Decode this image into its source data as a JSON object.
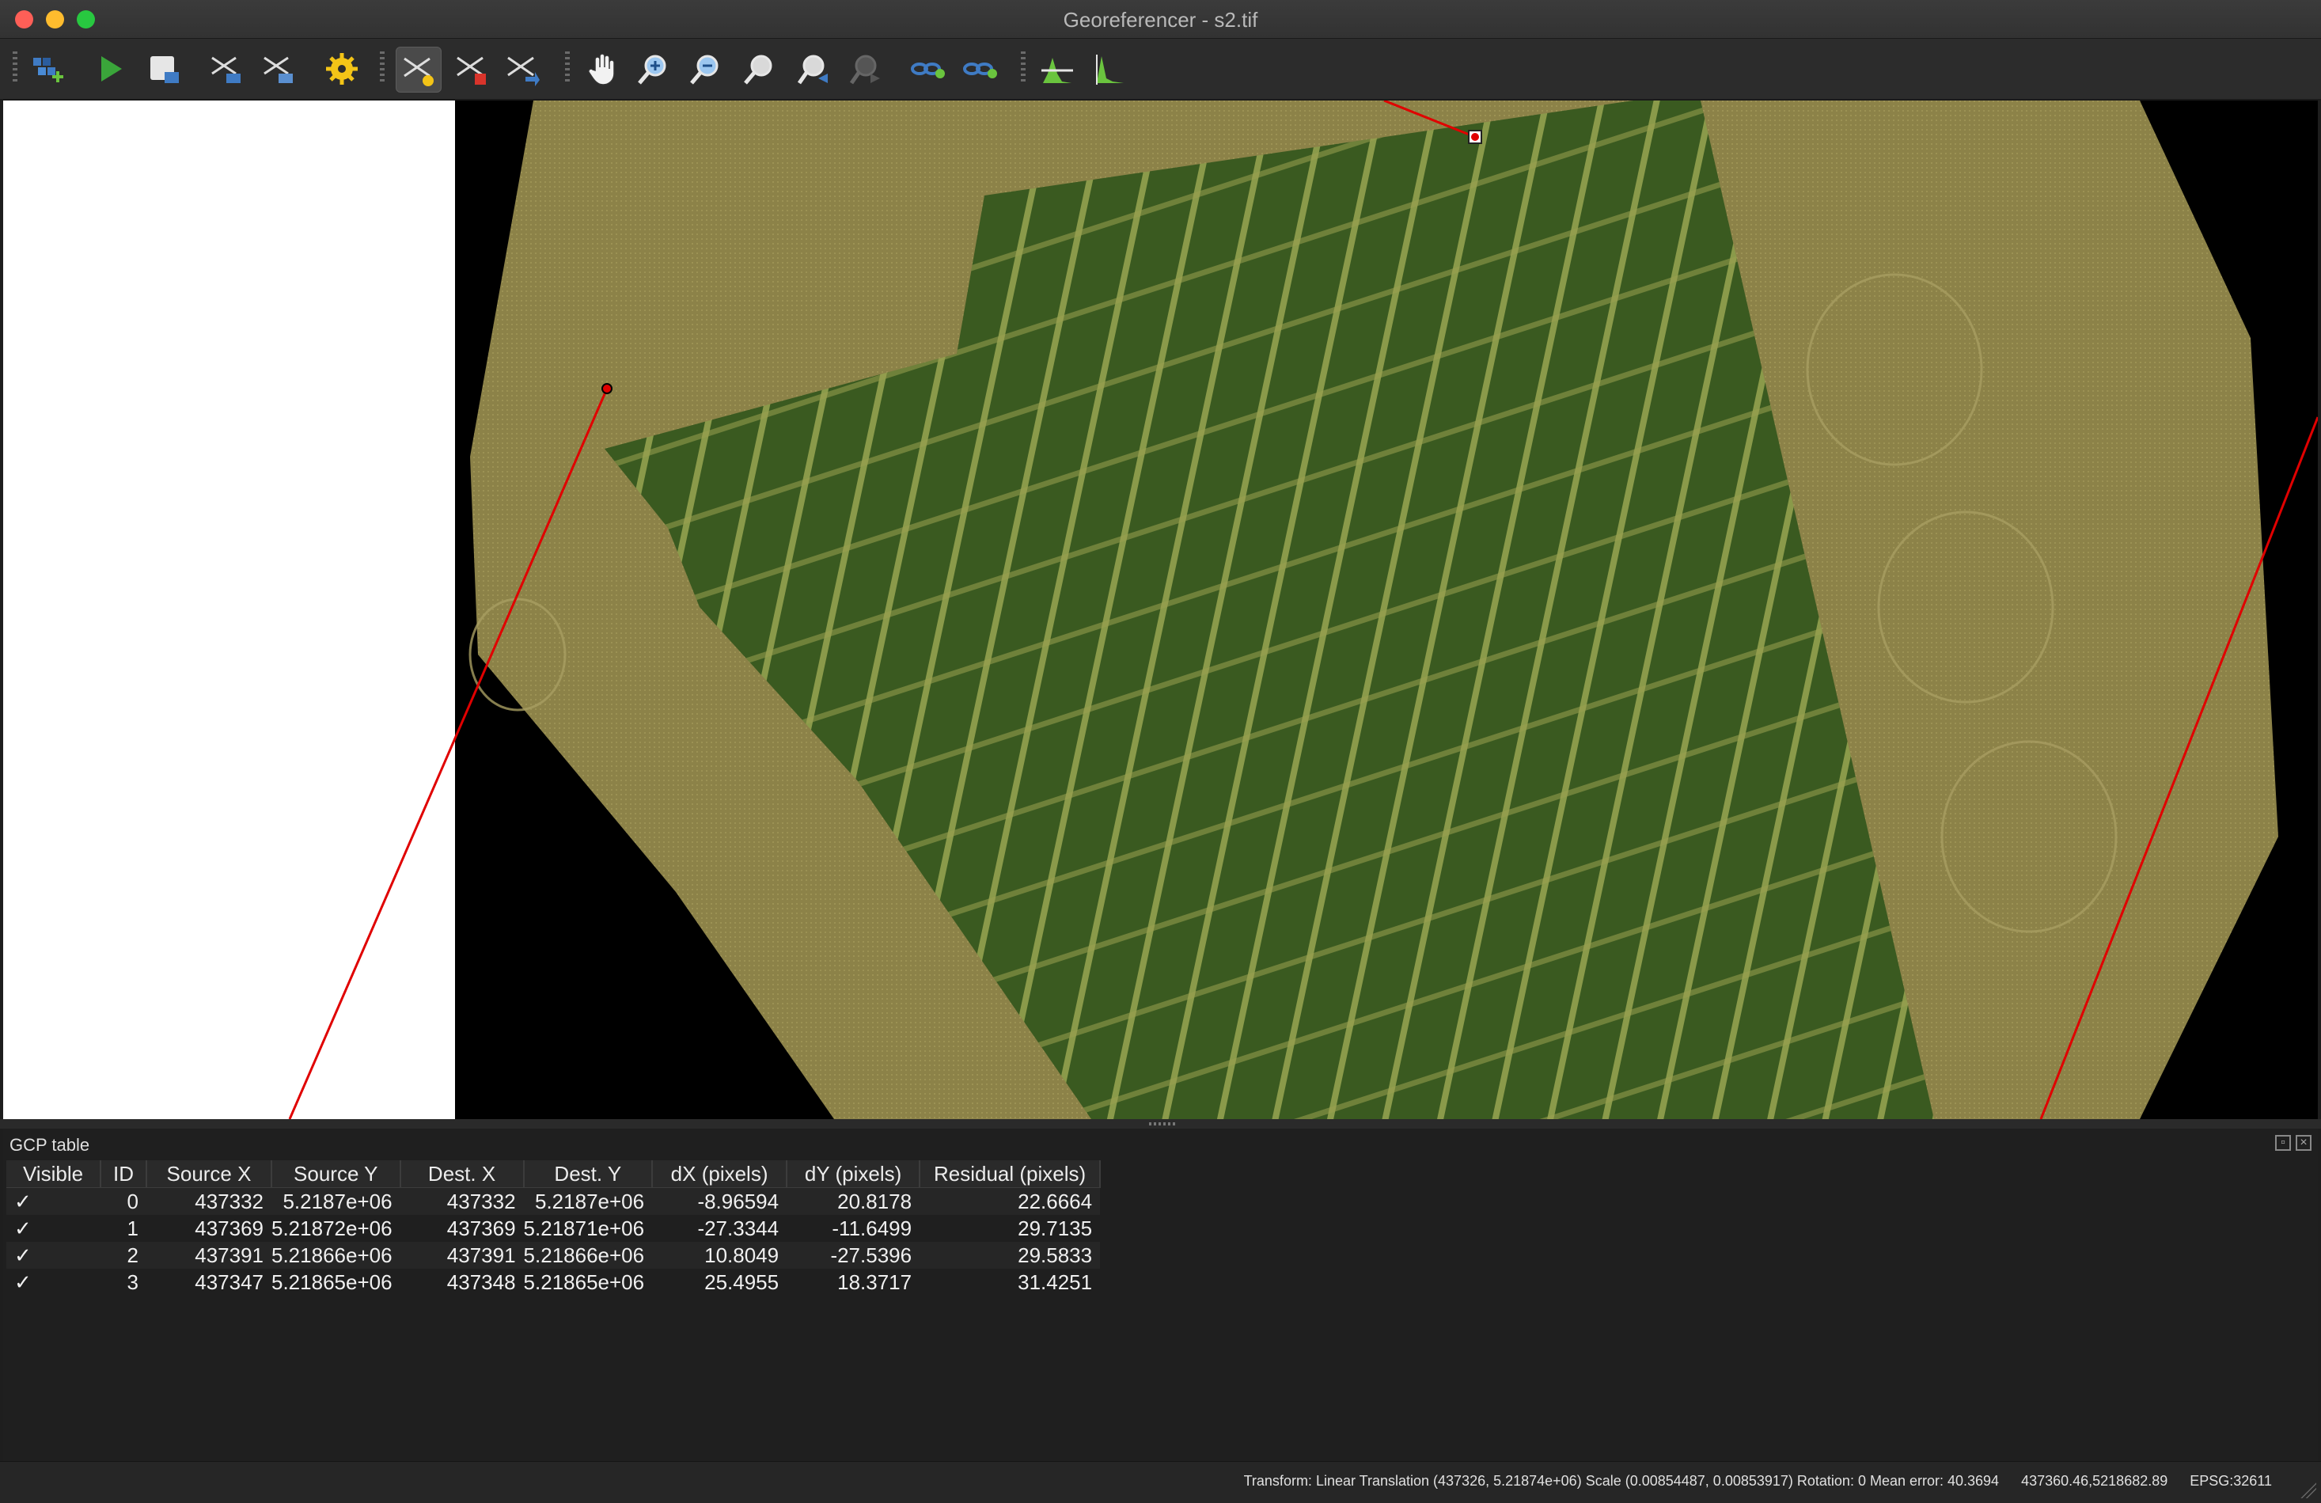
{
  "window": {
    "title": "Georeferencer - s2.tif"
  },
  "toolbar": {
    "buttons": [
      {
        "icon": "open-raster-icon",
        "label": "Open Raster"
      },
      {
        "icon": "start-georeferencing-icon",
        "label": "Start Georeferencing"
      },
      {
        "icon": "generate-gdal-script-icon",
        "label": "Generate GDAL Script"
      },
      {
        "icon": "load-gcp-points-icon",
        "label": "Load GCP Points"
      },
      {
        "icon": "save-gcp-points-icon",
        "label": "Save GCP Points As"
      },
      {
        "icon": "transformation-settings-icon",
        "label": "Transformation Settings"
      },
      {
        "icon": "add-point-icon",
        "label": "Add Point"
      },
      {
        "icon": "delete-point-icon",
        "label": "Delete Point"
      },
      {
        "icon": "move-gcp-point-icon",
        "label": "Move GCP Point"
      },
      {
        "icon": "pan-icon",
        "label": "Pan"
      },
      {
        "icon": "zoom-in-icon",
        "label": "Zoom In"
      },
      {
        "icon": "zoom-out-icon",
        "label": "Zoom Out"
      },
      {
        "icon": "zoom-to-layer-icon",
        "label": "Zoom to Layer"
      },
      {
        "icon": "zoom-last-icon",
        "label": "Zoom Last"
      },
      {
        "icon": "zoom-next-icon",
        "label": "Zoom Next"
      },
      {
        "icon": "link-georeferencer-to-qgis-icon",
        "label": "Link Georeferencer to QGIS"
      },
      {
        "icon": "link-qgis-to-georeferencer-icon",
        "label": "Link QGIS to Georeferencer"
      },
      {
        "icon": "full-histogram-stretch-icon",
        "label": "Full Histogram Stretch"
      },
      {
        "icon": "local-histogram-stretch-icon",
        "label": "Local Histogram Stretch"
      }
    ]
  },
  "gcp_panel": {
    "title": "GCP table",
    "columns": [
      "Visible",
      "ID",
      "Source X",
      "Source Y",
      "Dest. X",
      "Dest. Y",
      "dX (pixels)",
      "dY (pixels)",
      "Residual (pixels)"
    ],
    "rows": [
      {
        "visible": "✓",
        "id": "0",
        "source_x": "437332",
        "source_y": "5.2187e+06",
        "dest_x": "437332",
        "dest_y": "5.2187e+06",
        "dx": "-8.96594",
        "dy": "20.8178",
        "residual": "22.6664"
      },
      {
        "visible": "✓",
        "id": "1",
        "source_x": "437369",
        "source_y": "5.21872e+06",
        "dest_x": "437369",
        "dest_y": "5.21871e+06",
        "dx": "-27.3344",
        "dy": "-11.6499",
        "residual": "29.7135"
      },
      {
        "visible": "✓",
        "id": "2",
        "source_x": "437391",
        "source_y": "5.21866e+06",
        "dest_x": "437391",
        "dest_y": "5.21866e+06",
        "dx": "10.8049",
        "dy": "-27.5396",
        "residual": "29.5833"
      },
      {
        "visible": "✓",
        "id": "3",
        "source_x": "437347",
        "source_y": "5.21865e+06",
        "dest_x": "437348",
        "dest_y": "5.21865e+06",
        "dx": "25.4955",
        "dy": "18.3717",
        "residual": "31.4251"
      }
    ]
  },
  "statusbar": {
    "transform": "Transform: Linear Translation (437326, 5.21874e+06) Scale (0.00854487, 0.00853917) Rotation: 0 Mean error: 40.3694",
    "coordinates": "437360.46,5218682.89",
    "crs": "EPSG:32611"
  },
  "colors": {
    "gcp_line": "#e00000",
    "field_bare": "#8a7f4a",
    "crop": "#3d5a22",
    "background": "#000000"
  }
}
